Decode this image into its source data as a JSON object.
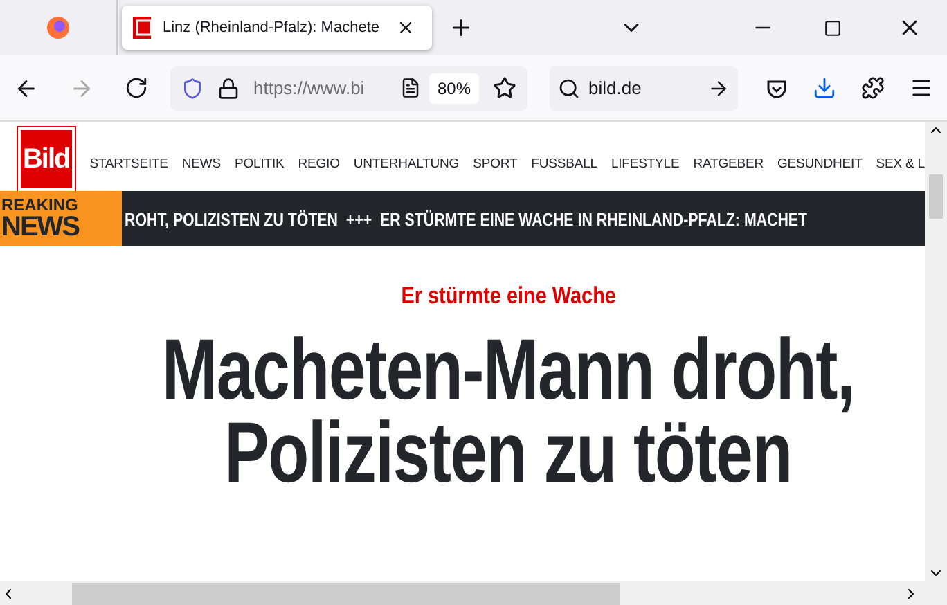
{
  "browser": {
    "tabs": [
      {
        "title": "Linz (Rheinland-Pfalz): Machete",
        "selected": true
      }
    ],
    "url": "https://www.bi",
    "zoom": "80%",
    "search": "bild.de"
  },
  "site": {
    "logo": "Bild",
    "nav": [
      {
        "label": "STARTSEITE"
      },
      {
        "label": "NEWS"
      },
      {
        "label": "POLITIK"
      },
      {
        "label": "REGIO"
      },
      {
        "label": "UNTERHALTUNG"
      },
      {
        "label": "SPORT"
      },
      {
        "label": "FUSSBALL"
      },
      {
        "label": "LIFESTYLE"
      },
      {
        "label": "RATGEBER"
      },
      {
        "label": "GESUNDHEIT"
      },
      {
        "label": "SEX & L"
      }
    ],
    "breaking": {
      "label_top": "REAKING",
      "label_bottom": "NEWS",
      "ticker": "ROHT, POLIZISTEN ZU TÖTEN  +++  ER STÜRMTE EINE WACHE IN RHEINLAND-PFALZ: MACHET"
    },
    "article": {
      "kicker": "Er stürmte eine Wache",
      "headline": "Macheten-Mann droht, Polizisten zu töten"
    }
  }
}
